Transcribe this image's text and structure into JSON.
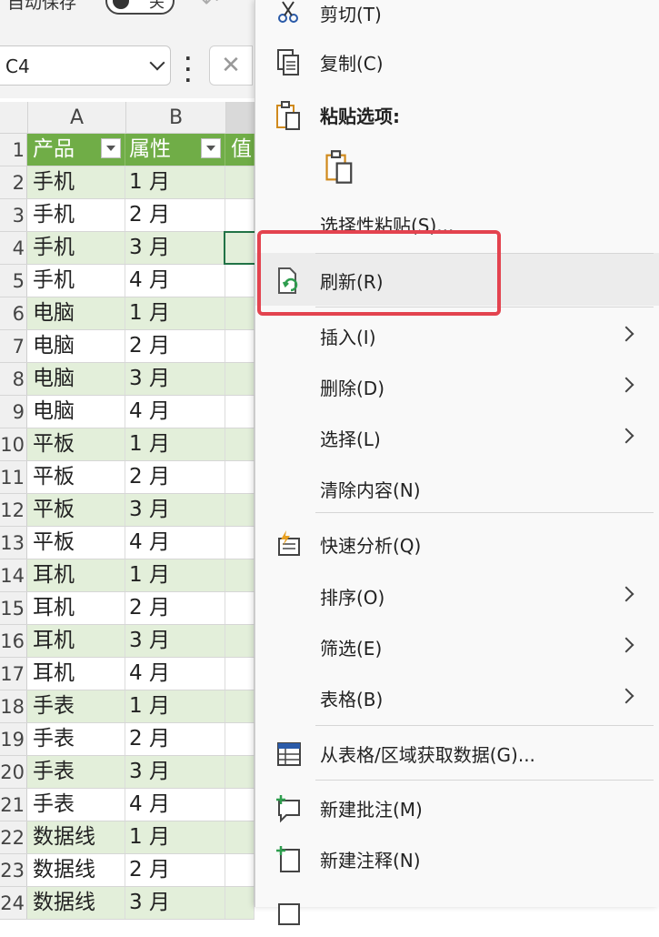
{
  "titlebar": {
    "autosave_label": "自动保存",
    "autosave_state": "关"
  },
  "formula_bar": {
    "name_box": "C4"
  },
  "sheet": {
    "columns": [
      "A",
      "B"
    ],
    "header": [
      "产品",
      "属性",
      "值"
    ],
    "rows": [
      {
        "num": "2",
        "a": "手机",
        "b": "1 月"
      },
      {
        "num": "3",
        "a": "手机",
        "b": "2 月"
      },
      {
        "num": "4",
        "a": "手机",
        "b": "3 月"
      },
      {
        "num": "5",
        "a": "手机",
        "b": "4 月"
      },
      {
        "num": "6",
        "a": "电脑",
        "b": "1 月"
      },
      {
        "num": "7",
        "a": "电脑",
        "b": "2 月"
      },
      {
        "num": "8",
        "a": "电脑",
        "b": "3 月"
      },
      {
        "num": "9",
        "a": "电脑",
        "b": "4 月"
      },
      {
        "num": "10",
        "a": "平板",
        "b": "1 月"
      },
      {
        "num": "11",
        "a": "平板",
        "b": "2 月"
      },
      {
        "num": "12",
        "a": "平板",
        "b": "3 月"
      },
      {
        "num": "13",
        "a": "平板",
        "b": "4 月"
      },
      {
        "num": "14",
        "a": "耳机",
        "b": "1 月"
      },
      {
        "num": "15",
        "a": "耳机",
        "b": "2 月"
      },
      {
        "num": "16",
        "a": "耳机",
        "b": "3 月"
      },
      {
        "num": "17",
        "a": "耳机",
        "b": "4 月"
      },
      {
        "num": "18",
        "a": "手表",
        "b": "1 月"
      },
      {
        "num": "19",
        "a": "手表",
        "b": "2 月"
      },
      {
        "num": "20",
        "a": "手表",
        "b": "3 月"
      },
      {
        "num": "21",
        "a": "手表",
        "b": "4 月"
      },
      {
        "num": "22",
        "a": "数据线",
        "b": "1 月"
      },
      {
        "num": "23",
        "a": "数据线",
        "b": "2 月"
      },
      {
        "num": "24",
        "a": "数据线",
        "b": "3 月"
      }
    ]
  },
  "context_menu": {
    "cut": "剪切(T)",
    "copy": "复制(C)",
    "paste_options": "粘贴选项:",
    "paste_special": "选择性粘贴(S)...",
    "refresh": "刷新(R)",
    "insert": "插入(I)",
    "delete": "删除(D)",
    "select": "选择(L)",
    "clear_contents": "清除内容(N)",
    "quick_analysis": "快速分析(Q)",
    "sort": "排序(O)",
    "filter": "筛选(E)",
    "table": "表格(B)",
    "get_data": "从表格/区域获取数据(G)...",
    "new_comment": "新建批注(M)",
    "new_note": "新建注释(N)"
  },
  "colors": {
    "header_green": "#70ad47",
    "band_green": "#e3efda",
    "highlight_red": "#e3434f",
    "refresh_green": "#2e9d4e"
  }
}
